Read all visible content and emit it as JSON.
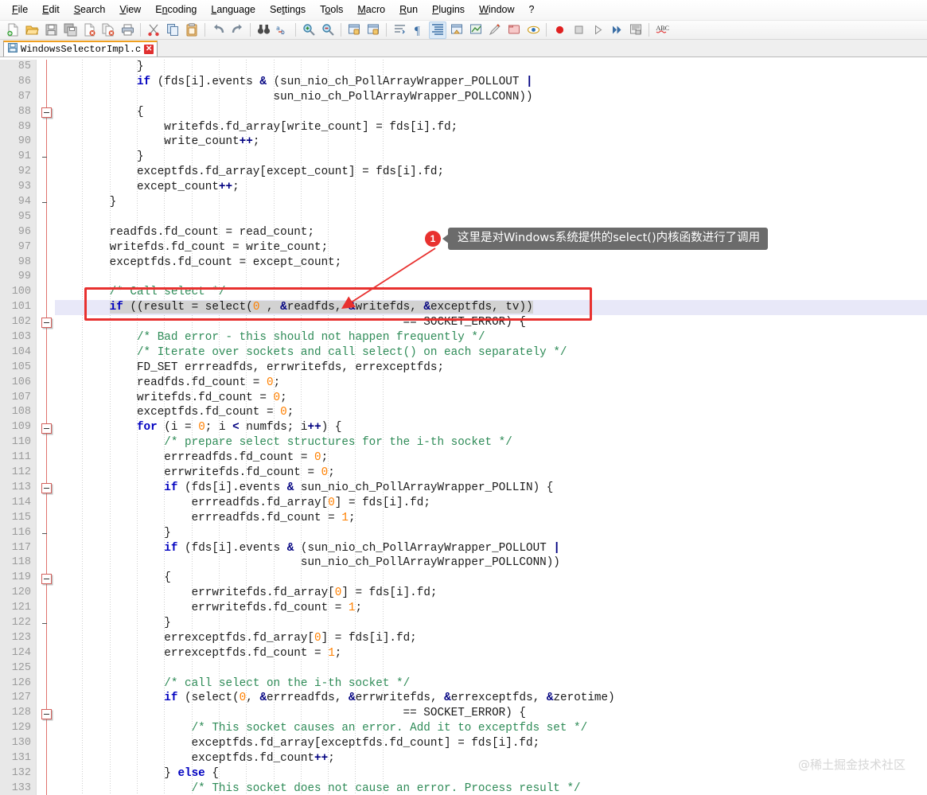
{
  "app": {
    "name": "Notepad++"
  },
  "menu": {
    "items": [
      {
        "label": "File",
        "accel": "F"
      },
      {
        "label": "Edit",
        "accel": "E"
      },
      {
        "label": "Search",
        "accel": "S"
      },
      {
        "label": "View",
        "accel": "V"
      },
      {
        "label": "Encoding",
        "accel": "n"
      },
      {
        "label": "Language",
        "accel": "L"
      },
      {
        "label": "Settings",
        "accel": "t"
      },
      {
        "label": "Tools",
        "accel": "o"
      },
      {
        "label": "Macro",
        "accel": "M"
      },
      {
        "label": "Run",
        "accel": "R"
      },
      {
        "label": "Plugins",
        "accel": "P"
      },
      {
        "label": "Window",
        "accel": "W"
      },
      {
        "label": "?",
        "accel": "?"
      }
    ]
  },
  "toolbar": {
    "buttons": [
      {
        "name": "new-file-icon",
        "glyph": "὜B",
        "kind": "doc-new"
      },
      {
        "name": "open-file-icon",
        "kind": "folder-open"
      },
      {
        "name": "save-icon",
        "kind": "floppy"
      },
      {
        "name": "save-all-icon",
        "kind": "floppy-multi"
      },
      {
        "name": "close-file-icon",
        "kind": "doc-close"
      },
      {
        "name": "close-all-icon",
        "kind": "doc-close-multi"
      },
      {
        "name": "print-icon",
        "kind": "printer"
      },
      {
        "sep": true
      },
      {
        "name": "cut-icon",
        "kind": "scissors"
      },
      {
        "name": "copy-icon",
        "kind": "copy"
      },
      {
        "name": "paste-icon",
        "kind": "clipboard"
      },
      {
        "sep": true
      },
      {
        "name": "undo-icon",
        "kind": "undo"
      },
      {
        "name": "redo-icon",
        "kind": "redo"
      },
      {
        "sep": true
      },
      {
        "name": "find-icon",
        "kind": "binoculars"
      },
      {
        "name": "replace-icon",
        "kind": "replace"
      },
      {
        "sep": true
      },
      {
        "name": "zoom-in-icon",
        "kind": "zoom-plus"
      },
      {
        "name": "zoom-out-icon",
        "kind": "zoom-minus"
      },
      {
        "sep": true
      },
      {
        "name": "sync-vertical-icon",
        "kind": "sync-v"
      },
      {
        "name": "sync-horizontal-icon",
        "kind": "sync-h"
      },
      {
        "sep": true
      },
      {
        "name": "word-wrap-icon",
        "kind": "wrap"
      },
      {
        "name": "show-all-chars-icon",
        "kind": "pilcrow"
      },
      {
        "name": "indent-guide-icon",
        "kind": "indent-guide",
        "active": true
      },
      {
        "name": "user-defined-dialog-icon",
        "kind": "udl"
      },
      {
        "name": "show-symbol-icon",
        "kind": "symbol"
      },
      {
        "name": "zoom-restore-icon",
        "kind": "pen"
      },
      {
        "name": "document-map-icon",
        "kind": "docmap"
      },
      {
        "name": "function-list-icon",
        "kind": "eye"
      },
      {
        "sep": true
      },
      {
        "name": "record-macro-icon",
        "kind": "record"
      },
      {
        "name": "stop-macro-icon",
        "kind": "stop"
      },
      {
        "name": "play-macro-icon",
        "kind": "play"
      },
      {
        "name": "play-multi-macro-icon",
        "kind": "play-multi"
      },
      {
        "name": "save-macro-icon",
        "kind": "save-macro"
      },
      {
        "sep": true
      },
      {
        "name": "spell-check-icon",
        "kind": "abc"
      }
    ]
  },
  "tabs": [
    {
      "label": "WindowsSelectorImpl.c",
      "active": true,
      "close": "✕"
    }
  ],
  "editor": {
    "first_line": 85,
    "current_line": 101,
    "line_height": 18.9,
    "lines": [
      {
        "n": 85,
        "tokens": [
          {
            "t": "            }"
          }
        ]
      },
      {
        "n": 86,
        "tokens": [
          {
            "t": "            "
          },
          {
            "t": "if",
            "c": "kw"
          },
          {
            "t": " (fds[i].events "
          },
          {
            "t": "&",
            "c": "op"
          },
          {
            "t": " (sun_nio_ch_PollArrayWrapper_POLLOUT "
          },
          {
            "t": "|",
            "c": "op"
          }
        ]
      },
      {
        "n": 87,
        "tokens": [
          {
            "t": "                                sun_nio_ch_PollArrayWrapper_POLLCONN))"
          }
        ]
      },
      {
        "n": 88,
        "tokens": [
          {
            "t": "            {"
          }
        ],
        "fold": true
      },
      {
        "n": 89,
        "tokens": [
          {
            "t": "                writefds.fd_array[write_count] = fds[i].fd;"
          }
        ]
      },
      {
        "n": 90,
        "tokens": [
          {
            "t": "                write_count"
          },
          {
            "t": "++",
            "c": "op"
          },
          {
            "t": ";"
          }
        ]
      },
      {
        "n": 91,
        "tokens": [
          {
            "t": "            }"
          }
        ],
        "tick": true
      },
      {
        "n": 92,
        "tokens": [
          {
            "t": "            exceptfds.fd_array[except_count] = fds[i].fd;"
          }
        ]
      },
      {
        "n": 93,
        "tokens": [
          {
            "t": "            except_count"
          },
          {
            "t": "++",
            "c": "op"
          },
          {
            "t": ";"
          }
        ]
      },
      {
        "n": 94,
        "tokens": [
          {
            "t": "        }"
          }
        ],
        "tick": true
      },
      {
        "n": 95,
        "tokens": [
          {
            "t": ""
          }
        ]
      },
      {
        "n": 96,
        "tokens": [
          {
            "t": "        readfds.fd_count = read_count;"
          }
        ]
      },
      {
        "n": 97,
        "tokens": [
          {
            "t": "        writefds.fd_count = write_count;"
          }
        ]
      },
      {
        "n": 98,
        "tokens": [
          {
            "t": "        exceptfds.fd_count = except_count;"
          }
        ]
      },
      {
        "n": 99,
        "tokens": [
          {
            "t": ""
          }
        ]
      },
      {
        "n": 100,
        "tokens": [
          {
            "t": "        "
          },
          {
            "t": "/* Call select */",
            "c": "cm"
          }
        ]
      },
      {
        "n": 101,
        "tokens": [
          {
            "t": "        "
          },
          {
            "t": "if",
            "c": "kw sel"
          },
          {
            "t": " ((result = select(",
            "c": "sel"
          },
          {
            "t": "0",
            "c": "num sel"
          },
          {
            "t": " , ",
            "c": "sel"
          },
          {
            "t": "&",
            "c": "op sel"
          },
          {
            "t": "readfds, ",
            "c": "sel"
          },
          {
            "t": "&",
            "c": "op sel"
          },
          {
            "t": "writefds, ",
            "c": "sel"
          },
          {
            "t": "&",
            "c": "op sel"
          },
          {
            "t": "exceptfds, tv))",
            "c": "sel"
          }
        ],
        "current": true
      },
      {
        "n": 102,
        "tokens": [
          {
            "t": "                                                   == SOCKET_ERROR) {"
          }
        ],
        "fold": true
      },
      {
        "n": 103,
        "tokens": [
          {
            "t": "            "
          },
          {
            "t": "/* Bad error - this should not happen frequently */",
            "c": "cm"
          }
        ]
      },
      {
        "n": 104,
        "tokens": [
          {
            "t": "            "
          },
          {
            "t": "/* Iterate over sockets and call select() on each separately */",
            "c": "cm"
          }
        ]
      },
      {
        "n": 105,
        "tokens": [
          {
            "t": "            FD_SET errreadfds, errwritefds, errexceptfds;"
          }
        ]
      },
      {
        "n": 106,
        "tokens": [
          {
            "t": "            readfds.fd_count = "
          },
          {
            "t": "0",
            "c": "num"
          },
          {
            "t": ";"
          }
        ]
      },
      {
        "n": 107,
        "tokens": [
          {
            "t": "            writefds.fd_count = "
          },
          {
            "t": "0",
            "c": "num"
          },
          {
            "t": ";"
          }
        ]
      },
      {
        "n": 108,
        "tokens": [
          {
            "t": "            exceptfds.fd_count = "
          },
          {
            "t": "0",
            "c": "num"
          },
          {
            "t": ";"
          }
        ]
      },
      {
        "n": 109,
        "tokens": [
          {
            "t": "            "
          },
          {
            "t": "for",
            "c": "kw"
          },
          {
            "t": " (i = "
          },
          {
            "t": "0",
            "c": "num"
          },
          {
            "t": "; i "
          },
          {
            "t": "<",
            "c": "op"
          },
          {
            "t": " numfds; i"
          },
          {
            "t": "++",
            "c": "op"
          },
          {
            "t": ") {"
          }
        ],
        "fold": true
      },
      {
        "n": 110,
        "tokens": [
          {
            "t": "                "
          },
          {
            "t": "/* prepare select structures for the i-th socket */",
            "c": "cm"
          }
        ]
      },
      {
        "n": 111,
        "tokens": [
          {
            "t": "                errreadfds.fd_count = "
          },
          {
            "t": "0",
            "c": "num"
          },
          {
            "t": ";"
          }
        ]
      },
      {
        "n": 112,
        "tokens": [
          {
            "t": "                errwritefds.fd_count = "
          },
          {
            "t": "0",
            "c": "num"
          },
          {
            "t": ";"
          }
        ]
      },
      {
        "n": 113,
        "tokens": [
          {
            "t": "                "
          },
          {
            "t": "if",
            "c": "kw"
          },
          {
            "t": " (fds[i].events "
          },
          {
            "t": "&",
            "c": "op"
          },
          {
            "t": " sun_nio_ch_PollArrayWrapper_POLLIN) {"
          }
        ],
        "fold": true
      },
      {
        "n": 114,
        "tokens": [
          {
            "t": "                    errreadfds.fd_array["
          },
          {
            "t": "0",
            "c": "num"
          },
          {
            "t": "] = fds[i].fd;"
          }
        ]
      },
      {
        "n": 115,
        "tokens": [
          {
            "t": "                    errreadfds.fd_count = "
          },
          {
            "t": "1",
            "c": "num"
          },
          {
            "t": ";"
          }
        ]
      },
      {
        "n": 116,
        "tokens": [
          {
            "t": "                }"
          }
        ],
        "tick": true
      },
      {
        "n": 117,
        "tokens": [
          {
            "t": "                "
          },
          {
            "t": "if",
            "c": "kw"
          },
          {
            "t": " (fds[i].events "
          },
          {
            "t": "&",
            "c": "op"
          },
          {
            "t": " (sun_nio_ch_PollArrayWrapper_POLLOUT "
          },
          {
            "t": "|",
            "c": "op"
          }
        ]
      },
      {
        "n": 118,
        "tokens": [
          {
            "t": "                                    sun_nio_ch_PollArrayWrapper_POLLCONN))"
          }
        ]
      },
      {
        "n": 119,
        "tokens": [
          {
            "t": "                {"
          }
        ],
        "fold": true
      },
      {
        "n": 120,
        "tokens": [
          {
            "t": "                    errwritefds.fd_array["
          },
          {
            "t": "0",
            "c": "num"
          },
          {
            "t": "] = fds[i].fd;"
          }
        ]
      },
      {
        "n": 121,
        "tokens": [
          {
            "t": "                    errwritefds.fd_count = "
          },
          {
            "t": "1",
            "c": "num"
          },
          {
            "t": ";"
          }
        ]
      },
      {
        "n": 122,
        "tokens": [
          {
            "t": "                }"
          }
        ],
        "tick": true
      },
      {
        "n": 123,
        "tokens": [
          {
            "t": "                errexceptfds.fd_array["
          },
          {
            "t": "0",
            "c": "num"
          },
          {
            "t": "] = fds[i].fd;"
          }
        ]
      },
      {
        "n": 124,
        "tokens": [
          {
            "t": "                errexceptfds.fd_count = "
          },
          {
            "t": "1",
            "c": "num"
          },
          {
            "t": ";"
          }
        ]
      },
      {
        "n": 125,
        "tokens": [
          {
            "t": ""
          }
        ]
      },
      {
        "n": 126,
        "tokens": [
          {
            "t": "                "
          },
          {
            "t": "/* call select on the i-th socket */",
            "c": "cm"
          }
        ]
      },
      {
        "n": 127,
        "tokens": [
          {
            "t": "                "
          },
          {
            "t": "if",
            "c": "kw"
          },
          {
            "t": " (select("
          },
          {
            "t": "0",
            "c": "num"
          },
          {
            "t": ", "
          },
          {
            "t": "&",
            "c": "op"
          },
          {
            "t": "errreadfds, "
          },
          {
            "t": "&",
            "c": "op"
          },
          {
            "t": "errwritefds, "
          },
          {
            "t": "&",
            "c": "op"
          },
          {
            "t": "errexceptfds, "
          },
          {
            "t": "&",
            "c": "op"
          },
          {
            "t": "zerotime)"
          }
        ]
      },
      {
        "n": 128,
        "tokens": [
          {
            "t": "                                                   == SOCKET_ERROR) {"
          }
        ],
        "fold": true
      },
      {
        "n": 129,
        "tokens": [
          {
            "t": "                    "
          },
          {
            "t": "/* This socket causes an error. Add it to exceptfds set */",
            "c": "cm"
          }
        ]
      },
      {
        "n": 130,
        "tokens": [
          {
            "t": "                    exceptfds.fd_array[exceptfds.fd_count] = fds[i].fd;"
          }
        ]
      },
      {
        "n": 131,
        "tokens": [
          {
            "t": "                    exceptfds.fd_count"
          },
          {
            "t": "++",
            "c": "op"
          },
          {
            "t": ";"
          }
        ]
      },
      {
        "n": 132,
        "tokens": [
          {
            "t": "                } "
          },
          {
            "t": "else",
            "c": "kw"
          },
          {
            "t": " {"
          }
        ]
      },
      {
        "n": 133,
        "tokens": [
          {
            "t": "                    "
          },
          {
            "t": "/* This socket does not cause an error. Process result */",
            "c": "cm"
          }
        ]
      }
    ]
  },
  "annotation": {
    "badge_number": "1",
    "callout_text": "这里是对Windows系统提供的select()内核函数进行了调用",
    "highlight_lines": [
      100,
      101
    ]
  },
  "watermark": {
    "text": "@稀土掘金技术社区"
  },
  "colors": {
    "accent_red": "#e8312f",
    "callout_bg": "#6b6b6b",
    "keyword": "#0000c0",
    "comment": "#2e8b57",
    "number": "#ff8000",
    "operator": "#000080",
    "current_line_bg": "#e8e8f8",
    "gutter_bg": "#e8e8e8",
    "tab_accent": "#f0a020"
  }
}
